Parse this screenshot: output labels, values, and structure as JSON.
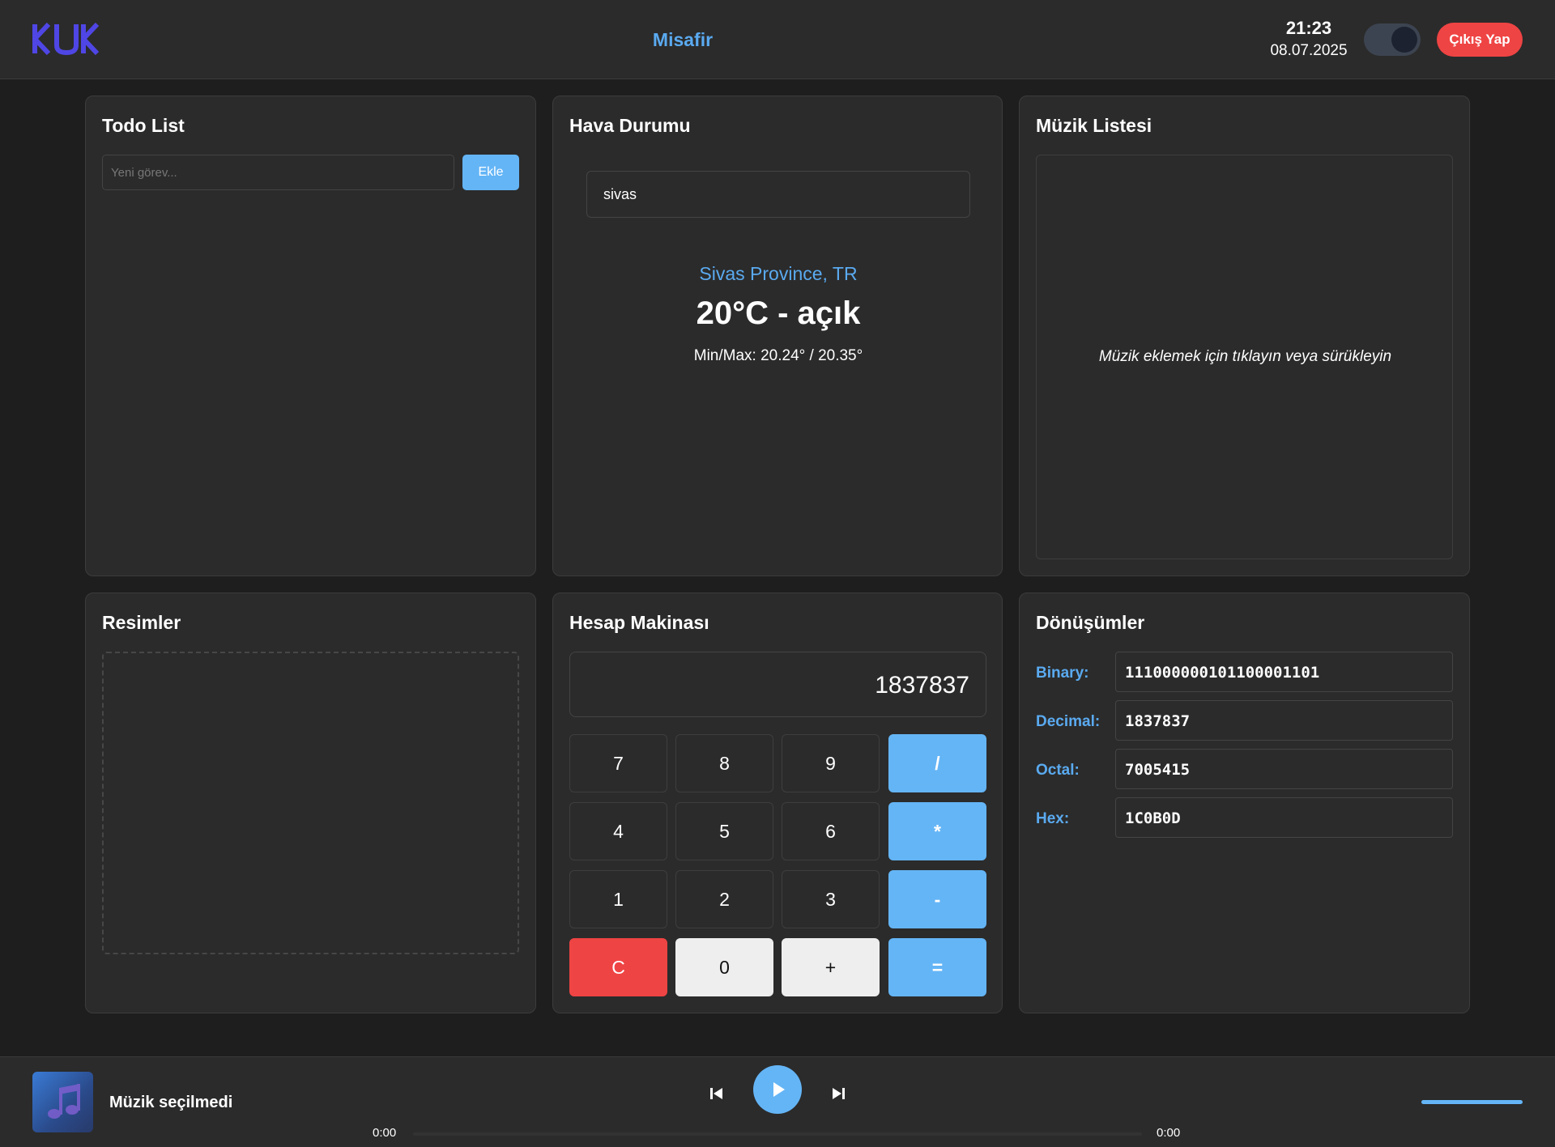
{
  "header": {
    "user_name": "Misafir",
    "time": "21:23",
    "date": "08.07.2025",
    "logout_label": "Çıkış Yap"
  },
  "todo": {
    "title": "Todo List",
    "input_placeholder": "Yeni görev...",
    "add_label": "Ekle"
  },
  "weather": {
    "title": "Hava Durumu",
    "city_value": "sivas",
    "location": "Sivas Province, TR",
    "temp": "20°C - açık",
    "minmax": "Min/Max: 20.24° / 20.35°"
  },
  "music_list": {
    "title": "Müzik Listesi",
    "drop_text": "Müzik eklemek için tıklayın veya sürükleyin"
  },
  "images": {
    "title": "Resimler"
  },
  "calculator": {
    "title": "Hesap Makinası",
    "display": "1837837",
    "keys": [
      "7",
      "8",
      "9",
      "/",
      "4",
      "5",
      "6",
      "*",
      "1",
      "2",
      "3",
      "-",
      "C",
      "0",
      "+",
      "="
    ]
  },
  "conversions": {
    "title": "Dönüşümler",
    "rows": [
      {
        "label": "Binary:",
        "value": "111000000101100001101"
      },
      {
        "label": "Decimal:",
        "value": "1837837"
      },
      {
        "label": "Octal:",
        "value": "7005415"
      },
      {
        "label": "Hex:",
        "value": "1C0B0D"
      }
    ]
  },
  "player": {
    "track_name": "Müzik seçilmedi",
    "current_time": "0:00",
    "duration": "0:00",
    "volume": 1.0
  },
  "colors": {
    "accent": "#64b5f6",
    "danger": "#ef4444",
    "logo": "#4f46e5"
  }
}
